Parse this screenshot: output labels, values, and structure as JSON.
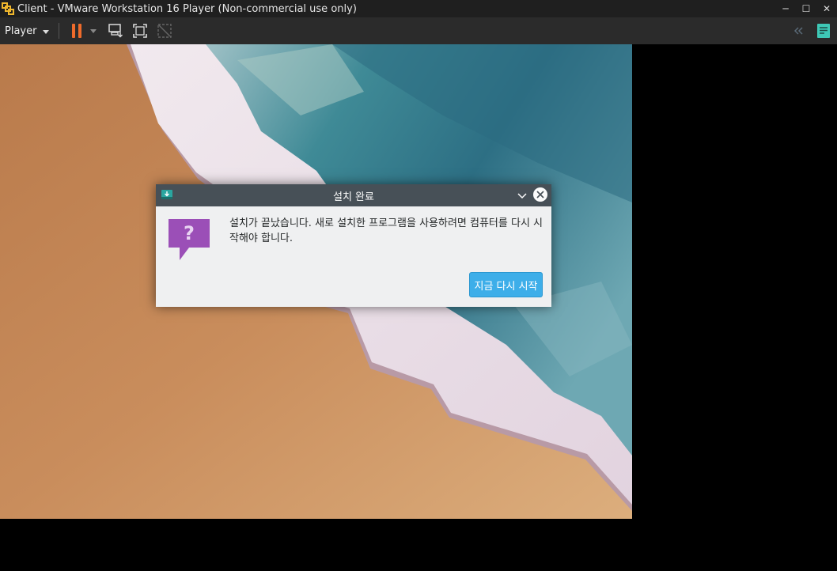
{
  "window": {
    "title": "Client - VMware Workstation 16 Player (Non-commercial use only)",
    "minimize_label": "─",
    "maximize_label": "☐",
    "close_label": "✕"
  },
  "toolbar": {
    "player_label": "Player"
  },
  "dialog": {
    "title": "설치 완료",
    "message": "설치가 끝났습니다. 새로 설치한 프로그램을 사용하려면 컴퓨터를 다시 시작해야 합니다.",
    "restart_button": "지금 다시 시작",
    "question_glyph": "?"
  },
  "colors": {
    "accent": "#3daee9",
    "pause": "#ef6b2b",
    "question_bubble": "#9b4fb7",
    "dialog_title_bg": "#475057"
  }
}
